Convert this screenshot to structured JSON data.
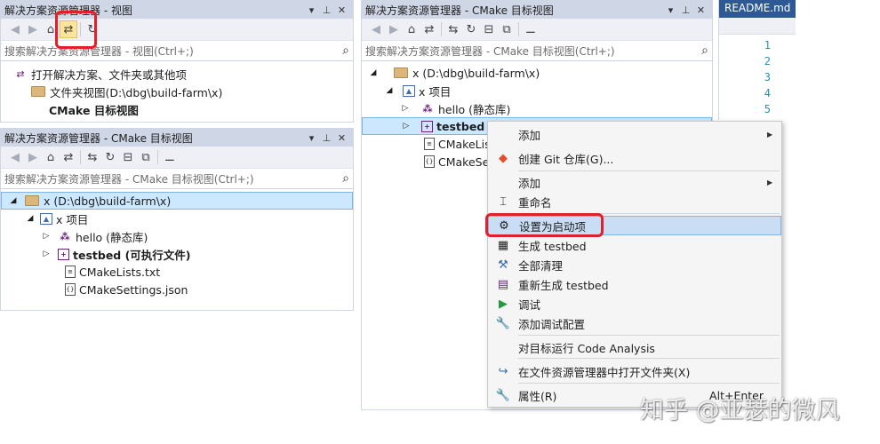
{
  "panel1": {
    "title": "解决方案资源管理器 - 视图",
    "search_placeholder": "搜索解决方案资源管理器 - 视图(Ctrl+;)",
    "items": [
      "打开解决方案、文件夹或其他项",
      "文件夹视图(D:\\dbg\\build-farm\\x)",
      "CMake 目标视图"
    ]
  },
  "panel2": {
    "title": "解决方案资源管理器 - CMake 目标视图",
    "search_placeholder": "搜索解决方案资源管理器 - CMake 目标视图(Ctrl+;)",
    "root": "x (D:\\dbg\\build-farm\\x)",
    "project": "x 项目",
    "hello": "hello (静态库)",
    "testbed": "testbed (可执行文件)",
    "cmakelists": "CMakeLists.txt",
    "cmakesettings": "CMakeSettings.json"
  },
  "panel3": {
    "title": "解决方案资源管理器 - CMake 目标视图",
    "search_placeholder": "搜索解决方案资源管理器 - CMake 目标视图(Ctrl+;)",
    "root": "x (D:\\dbg\\build-farm\\x)",
    "project": "x 项目",
    "hello": "hello (静态库)",
    "testbed": "testbed (",
    "cmakelists": "CMakeLis",
    "cmakesettings": "CMakeSe"
  },
  "editor": {
    "tab": "README.md",
    "line_numbers": [
      "1",
      "2",
      "3",
      "4",
      "5"
    ]
  },
  "context_menu": {
    "items": [
      {
        "label": "添加",
        "submenu": true,
        "icon": "none"
      },
      {
        "label": "创建 Git 仓库(G)...",
        "icon": "git-icon"
      },
      {
        "label": "添加",
        "submenu": true,
        "icon": "none"
      },
      {
        "label": "重命名",
        "icon": "rename-icon"
      },
      {
        "label": "设置为启动项",
        "icon": "gear-icon"
      },
      {
        "label": "生成 testbed",
        "icon": "build-icon"
      },
      {
        "label": "全部清理",
        "icon": "broom-icon"
      },
      {
        "label": "重新生成 testbed",
        "icon": "rebuild-icon"
      },
      {
        "label": "调试",
        "icon": "play-icon"
      },
      {
        "label": "添加调试配置",
        "icon": "wrench-icon"
      },
      {
        "label": "对目标运行 Code Analysis",
        "icon": "none"
      },
      {
        "label": "在文件资源管理器中打开文件夹(X)",
        "icon": "refresh-arrow-icon"
      },
      {
        "label": "属性(R)",
        "shortcut": "Alt+Enter",
        "icon": "wrench-icon"
      }
    ]
  },
  "watermark": "知乎 @亚瑟的微风",
  "colors": {
    "titlebar": "#cfd6e5",
    "highlight": "#e0202a",
    "selection": "#cce8ff"
  }
}
